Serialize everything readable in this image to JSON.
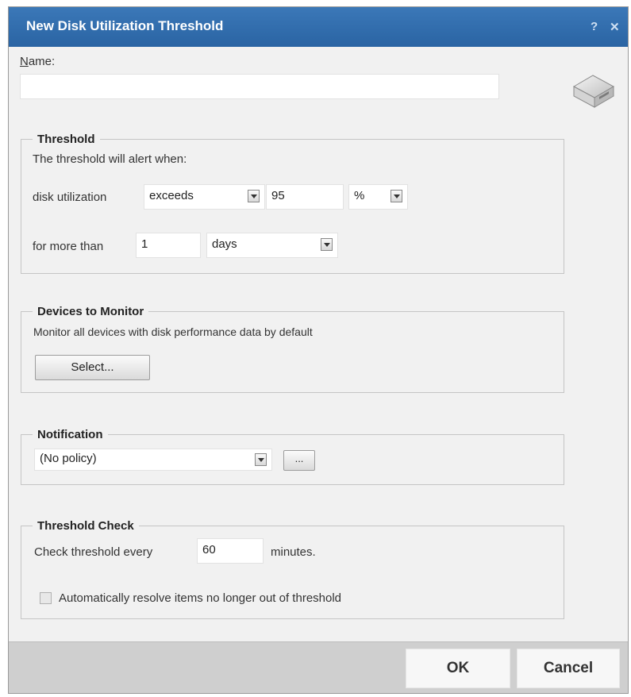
{
  "dialog": {
    "title": "New Disk Utilization Threshold",
    "help_label": "?",
    "close_label": "✕"
  },
  "name_field": {
    "label": "Name:",
    "value": ""
  },
  "threshold": {
    "legend": "Threshold",
    "description": "The threshold will alert when:",
    "metric_label": "disk utilization",
    "operator": "exceeds",
    "value": "95",
    "unit": "%",
    "duration_label": "for more than",
    "duration_value": "1",
    "duration_unit": "days"
  },
  "devices": {
    "legend": "Devices to Monitor",
    "description": "Monitor all devices with disk performance data by default",
    "select_label": "Select..."
  },
  "notification": {
    "legend": "Notification",
    "policy": "(No policy)",
    "browse_label": "..."
  },
  "threshold_check": {
    "legend": "Threshold Check",
    "check_prefix": "Check threshold every",
    "interval_value": "60",
    "interval_unit": "minutes.",
    "auto_resolve_label": "Automatically resolve items no longer out of threshold",
    "auto_resolve_checked": false
  },
  "footer": {
    "ok_label": "OK",
    "cancel_label": "Cancel"
  },
  "icons": {
    "disk": "hard-disk-icon"
  },
  "colors": {
    "titlebar": "#2f6dad",
    "dialog_bg": "#f1f1f1",
    "footer_bg": "#cfcfcf"
  }
}
